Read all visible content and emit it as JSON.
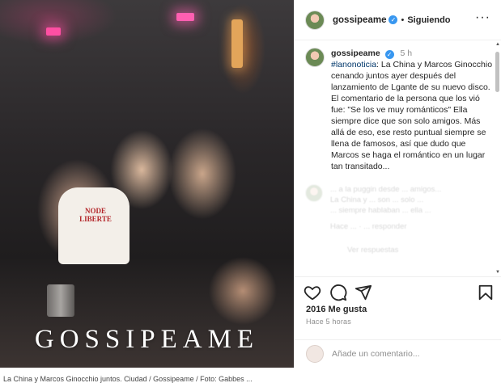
{
  "post": {
    "watermark": "GOSSIPEAME",
    "shirt_text": "NODE LIBERTE"
  },
  "header": {
    "username": "gossipeame",
    "separator": "•",
    "follow_state": "Siguiendo",
    "more": "···"
  },
  "caption": {
    "username": "gossipeame",
    "time": "5 h",
    "hashtag": "#lanonoticia",
    "text": ": La China y Marcos Ginocchio cenando juntos ayer después del lanzamiento de Lgante de su nuevo disco. El comentario de la persona que los vió fue: \"Se los ve muy románticos\" Ella siempre dice que son solo amigos. Más allá de eso, ese resto puntual siempre se llena de famosos, así que dudo que Marcos se haga el romántico en un lugar tan transitado..."
  },
  "faded_comment": {
    "lines": [
      "... a la puggin desde ... amigos...",
      "La China y ... son ... solo ...",
      "... siempre hablaban ... ella ..."
    ],
    "extra": "Hace ... · ... responder",
    "extra2": "Ver respuestas"
  },
  "actions": {
    "like_icon": "heart-icon",
    "comment_icon": "comment-icon",
    "share_icon": "send-icon",
    "save_icon": "bookmark-icon"
  },
  "likes": "2016 Me gusta",
  "time_ago": "Hace 5 horas",
  "add_comment": {
    "placeholder": "Añade un comentario..."
  },
  "image_caption": "La China y Marcos Ginocchio juntos. Ciudad / Gossipeame / Foto: Gabbes ..."
}
